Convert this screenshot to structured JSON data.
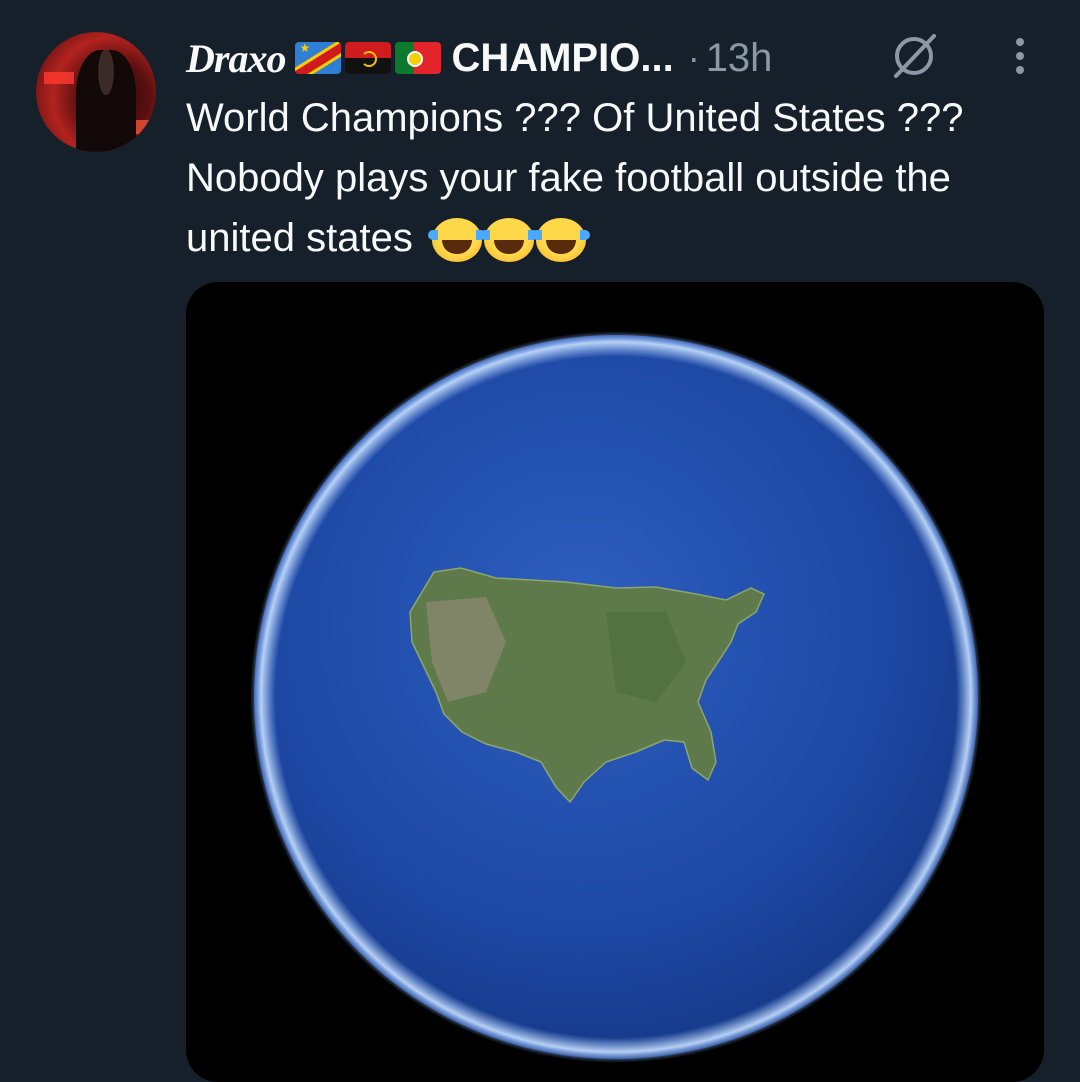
{
  "tweet": {
    "display_name": "Draxo",
    "flags": [
      "flag-dr-congo",
      "flag-angola",
      "flag-portugal"
    ],
    "handle_truncated": "CHAMPIO...",
    "separator": "·",
    "timestamp": "13h",
    "body": "World Champions ??? Of United States ??? Nobody plays your fake football outside the united states",
    "emojis": [
      "face-with-tears-of-joy",
      "face-with-tears-of-joy",
      "face-with-tears-of-joy"
    ],
    "media": {
      "type": "image",
      "depicts": "globe-icon"
    }
  },
  "colors": {
    "background": "#16202a",
    "text_primary": "#f7f9f9",
    "text_secondary": "#8b98a5",
    "ocean": "#1f4fa8",
    "land": "#5f7a4a"
  }
}
